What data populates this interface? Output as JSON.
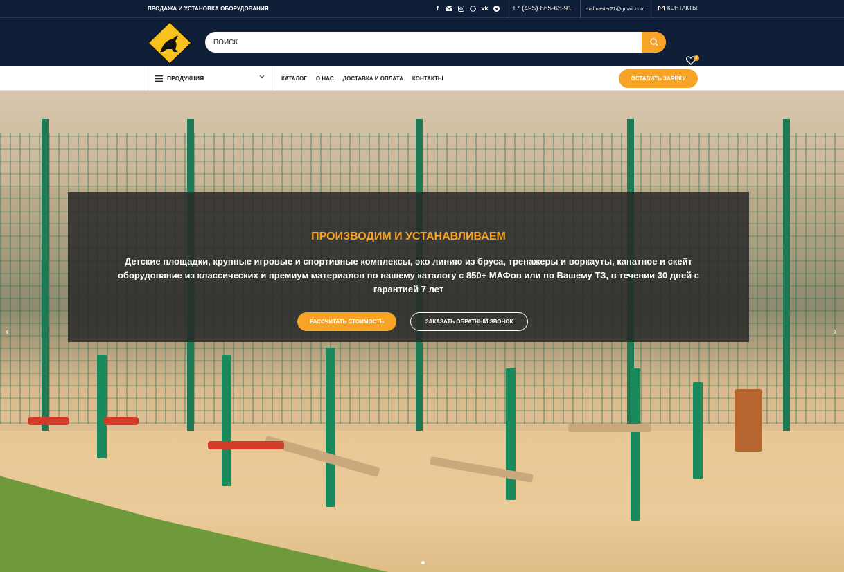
{
  "topbar": {
    "tagline": "ПРОДАЖА И УСТАНОВКА ОБОРУДОВАНИЯ",
    "social_icons": [
      "facebook-icon",
      "envelope-icon",
      "instagram-icon",
      "whatsapp-icon",
      "vk-icon",
      "telegram-icon"
    ],
    "phone": "+7 (495) 665-65-91",
    "email": "mafmaster21@gmail.com",
    "contacts_label": "КОНТАКТЫ"
  },
  "header": {
    "logo_icon": "kangaroo-logo-icon",
    "search_placeholder": "ПОИСК",
    "wishlist_count": "0"
  },
  "nav": {
    "products_label": "ПРОДУКЦИЯ",
    "items": [
      "КАТАЛОГ",
      "О НАС",
      "ДОСТАВКА И ОПЛАТА",
      "КОНТАКТЫ"
    ],
    "cta_label": "ОСТАВИТЬ ЗАЯВКУ"
  },
  "hero": {
    "title": "ПРОИЗВОДИМ И УСТАНАВЛИВАЕМ",
    "text": "Детские площадки, крупные игровые и спортивные комплексы, эко линию из бруса, тренажеры и воркауты, канатное и скейт оборудование из классических и премиум материалов по нашему каталогу с 850+ МАФов или по Вашему ТЗ, в течении 30 дней с гарантией 7 лет",
    "primary_button": "РАССЧИТАТЬ СТОИМОСТЬ",
    "secondary_button": "ЗАКАЗАТЬ ОБРАТНЫЙ ЗВОНОК"
  },
  "colors": {
    "accent": "#f7a325",
    "header_bg": "#0f1f38"
  }
}
